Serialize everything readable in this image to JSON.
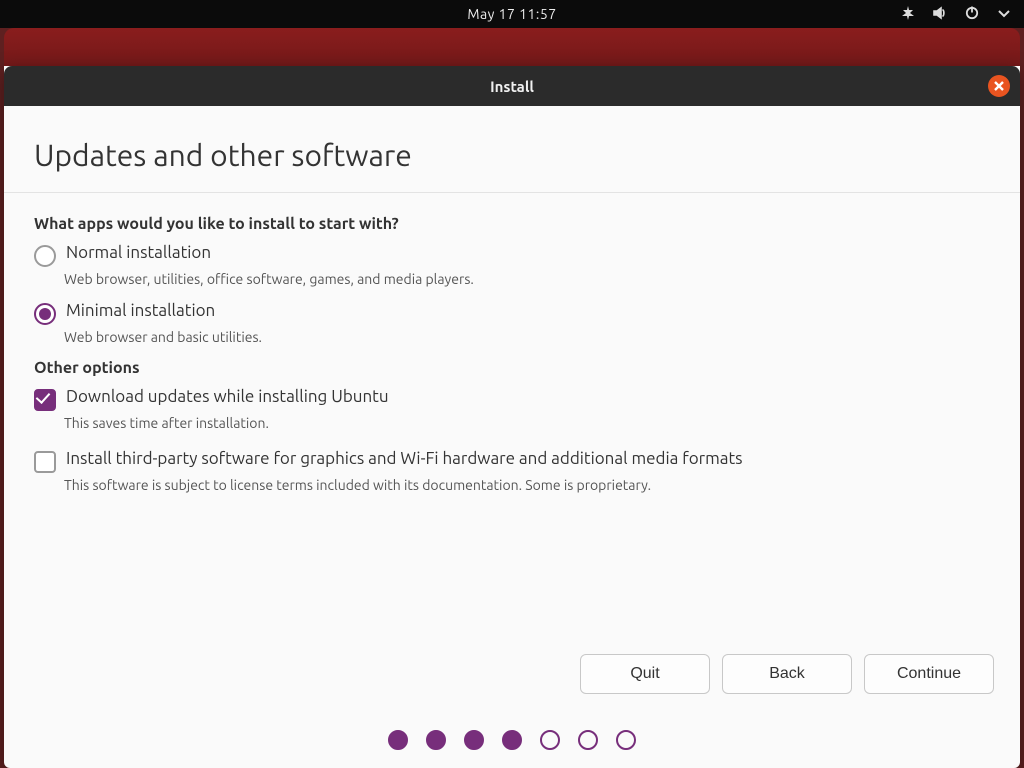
{
  "topbar": {
    "datetime": "May 17  11:57"
  },
  "window": {
    "title": "Install"
  },
  "page": {
    "heading": "Updates and other software",
    "question": "What apps would you like to install to start with?",
    "options": {
      "normal": {
        "label": "Normal installation",
        "sub": "Web browser, utilities, office software, games, and media players.",
        "selected": false
      },
      "minimal": {
        "label": "Minimal installation",
        "sub": "Web browser and basic utilities.",
        "selected": true
      }
    },
    "other_heading": "Other options",
    "other": {
      "download_updates": {
        "label": "Download updates while installing Ubuntu",
        "sub": "This saves time after installation.",
        "checked": true
      },
      "third_party": {
        "label": "Install third-party software for graphics and Wi-Fi hardware and additional media formats",
        "sub": "This software is subject to license terms included with its documentation. Some is proprietary.",
        "checked": false
      }
    }
  },
  "buttons": {
    "quit": "Quit",
    "back": "Back",
    "continue": "Continue"
  },
  "pager": {
    "total": 7,
    "current": 4
  },
  "colors": {
    "accent": "#772e7b",
    "close": "#e95420"
  }
}
